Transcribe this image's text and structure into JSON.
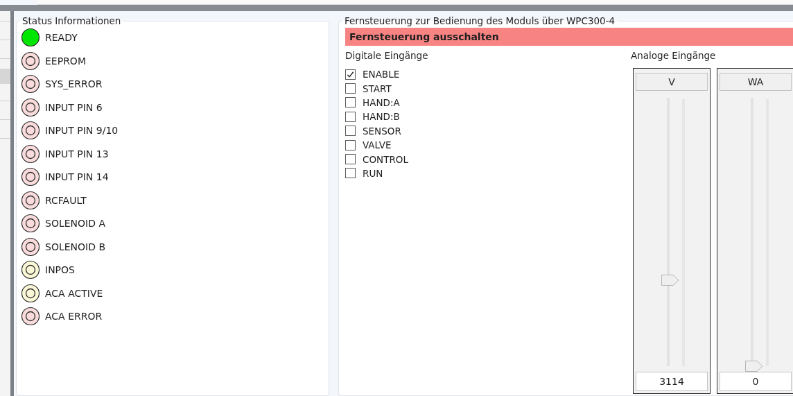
{
  "status_panel": {
    "title": "Status Informationen",
    "items": [
      {
        "label": "READY",
        "on": true,
        "color": "#00e600"
      },
      {
        "label": "EEPROM",
        "on": false,
        "color": "#fadcdc"
      },
      {
        "label": "SYS_ERROR",
        "on": false,
        "color": "#fadcdc"
      },
      {
        "label": "INPUT PIN 6",
        "on": false,
        "color": "#fadcdc"
      },
      {
        "label": "INPUT PIN 9/10",
        "on": false,
        "color": "#fadcdc"
      },
      {
        "label": "INPUT PIN 13",
        "on": false,
        "color": "#fadcdc"
      },
      {
        "label": "INPUT PIN 14",
        "on": false,
        "color": "#fadcdc"
      },
      {
        "label": "RCFAULT",
        "on": false,
        "color": "#fadcdc"
      },
      {
        "label": "SOLENOID A",
        "on": false,
        "color": "#fadcdc"
      },
      {
        "label": "SOLENOID B",
        "on": false,
        "color": "#fadcdc"
      },
      {
        "label": "INPOS",
        "on": false,
        "color": "#fbf8d8"
      },
      {
        "label": "ACA ACTIVE",
        "on": false,
        "color": "#fbf8d8"
      },
      {
        "label": "ACA ERROR",
        "on": false,
        "color": "#fadcdc"
      }
    ]
  },
  "remote_panel": {
    "title": "Fernsteuerung zur Bedienung des Moduls über WPC300-4",
    "toggle_button": "Fernsteuerung ausschalten",
    "digital_inputs": {
      "title": "Digitale Eingänge",
      "items": [
        {
          "label": "ENABLE",
          "checked": true
        },
        {
          "label": "START",
          "checked": false
        },
        {
          "label": "HAND:A",
          "checked": false
        },
        {
          "label": "HAND:B",
          "checked": false
        },
        {
          "label": "SENSOR",
          "checked": false
        },
        {
          "label": "VALVE",
          "checked": false
        },
        {
          "label": "CONTROL",
          "checked": false
        },
        {
          "label": "RUN",
          "checked": false
        }
      ]
    },
    "analog_inputs": {
      "title": "Analoge Eingänge",
      "channels": [
        {
          "name": "V",
          "level": 0.32,
          "value": "3114"
        },
        {
          "name": "WA",
          "level": 0,
          "value": "0"
        }
      ]
    }
  }
}
